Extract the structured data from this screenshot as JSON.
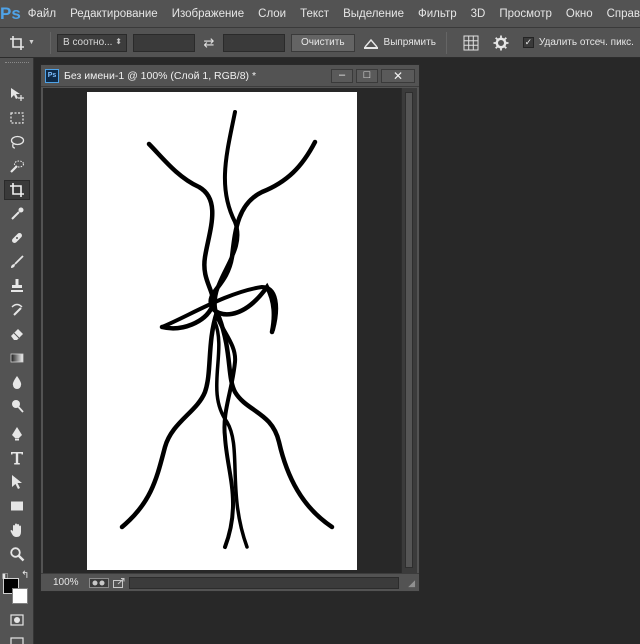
{
  "app": {
    "logo": "Ps"
  },
  "menu": [
    "Файл",
    "Редактирование",
    "Изображение",
    "Слои",
    "Текст",
    "Выделение",
    "Фильтр",
    "3D",
    "Просмотр",
    "Окно",
    "Справка"
  ],
  "options": {
    "ratio_select": "В соотно...",
    "clear_button": "Очистить",
    "straighten_label": "Выпрямить",
    "delete_pixels_label": "Удалить отсеч. пикс.",
    "delete_pixels_checked": true
  },
  "tools": {
    "icons": [
      "move-icon",
      "marquee-icon",
      "lasso-icon",
      "quick-selection-icon",
      "crop-icon",
      "eyedropper-icon",
      "healing-brush-icon",
      "brush-icon",
      "clone-stamp-icon",
      "history-brush-icon",
      "eraser-icon",
      "gradient-icon",
      "blur-icon",
      "dodge-icon",
      "pen-icon",
      "type-icon",
      "path-selection-icon",
      "rectangle-icon",
      "hand-icon",
      "zoom-icon"
    ],
    "active": "crop-icon",
    "foreground_color": "#000000",
    "background_color": "#ffffff"
  },
  "document": {
    "title": "Без имени-1 @ 100% (Слой 1, RGB/8) *",
    "badge": "Ps",
    "zoom": "100%",
    "minimize": "–",
    "maximize": "□",
    "close": "✕"
  },
  "colors": {
    "ui_bg": "#535353",
    "workspace": "#282828",
    "canvas": "#ffffff",
    "stroke": "#000000",
    "accent": "#4fa3e8"
  }
}
